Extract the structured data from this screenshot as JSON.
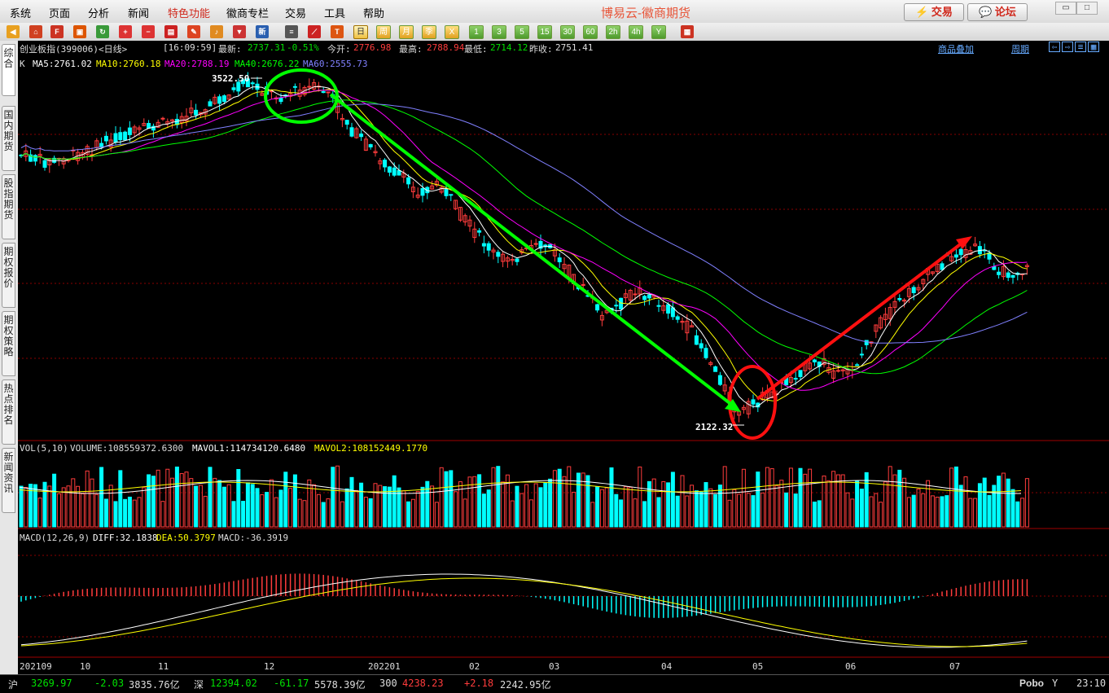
{
  "menu": {
    "items": [
      "系统",
      "页面",
      "分析",
      "新闻",
      "特色功能",
      "徽商专栏",
      "交易",
      "工具",
      "帮助"
    ],
    "title": "博易云-徽商期货",
    "trade_button": "交易",
    "forum_button": "论坛"
  },
  "toolbar": {
    "periods": [
      "日",
      "周",
      "月",
      "季",
      "X",
      "1",
      "3",
      "5",
      "15",
      "30",
      "60",
      "2h",
      "4h",
      "Y"
    ],
    "icons": [
      "back-arrow-icon",
      "home-icon",
      "f10-icon",
      "refresh-icon",
      "zoom-in-icon",
      "zoom-out-icon",
      "window-icon",
      "pen-icon",
      "bell-icon",
      "filter-icon",
      "new-icon",
      "list-icon",
      "chart-line-icon",
      "tick-icon"
    ]
  },
  "sidebar": {
    "tabs": [
      "综合",
      "国内期货",
      "股指期货",
      "期权报价",
      "期权策略",
      "热点排名",
      "新闻资讯"
    ]
  },
  "header": {
    "symbol": "创业板指(399006)<日线>",
    "time": "[16:09:59]",
    "last_label": "最新:",
    "last": "2737.31",
    "change": "-0.51%",
    "open_label": "今开:",
    "open": "2776.98",
    "high_label": "最高:",
    "high": "2788.94",
    "low_label": "最低:",
    "low": "2714.12",
    "prev_label": "昨收:",
    "prev": "2751.41",
    "overlay_link": "商品叠加",
    "period_link": "周期"
  },
  "ma_legend": {
    "prefix": "K",
    "ma5": "MA5:2761.02",
    "ma10": "MA10:2760.18",
    "ma20": "MA20:2788.19",
    "ma40": "MA40:2676.22",
    "ma60": "MA60:2555.73",
    "colors": {
      "ma5": "#ffffff",
      "ma10": "#ffff00",
      "ma20": "#ff00ff",
      "ma40": "#00ff00",
      "ma60": "#8080ff"
    }
  },
  "vol_legend": {
    "name": "VOL(5,10)",
    "volume": "VOLUME:108559372.6300",
    "mavol1": "MAVOL1:114734120.6480",
    "mavol2": "MAVOL2:108152449.1770"
  },
  "macd_legend": {
    "name": "MACD(12,26,9)",
    "diff": "DIFF:32.1838",
    "dea": "DEA:50.3797",
    "macd": "MACD:-36.3919"
  },
  "annotations": {
    "high_label": "3522.50",
    "low_label": "2122.32"
  },
  "x_axis": [
    "202109",
    "10",
    "11",
    "12",
    "202201",
    "02",
    "03",
    "04",
    "05",
    "06",
    "07"
  ],
  "chart_data": {
    "type": "candlestick",
    "symbol": "创业板指(399006)",
    "period": "日线",
    "high_marker": 3522.5,
    "low_marker": 2122.32,
    "last": 2737.31,
    "macd": {
      "diff": 32.1838,
      "dea": 50.3797,
      "macd": -36.3919
    },
    "volume": {
      "volume": 108559372.63,
      "mavol1": 114734120.648,
      "mavol2": 108152449.177
    },
    "trend_arrows": [
      {
        "color": "green",
        "from": "202112",
        "to": "202204"
      },
      {
        "color": "red",
        "from": "202205",
        "to": "202207"
      }
    ],
    "bullish_color": "#ff3c3c",
    "bearish_color": "#00ffff"
  },
  "status": {
    "sh_label": "沪",
    "sh_index": "3269.97",
    "sh_change": "-2.03",
    "sh_amount": "3835.76亿",
    "sz_label": "深",
    "sz_index": "12394.02",
    "sz_change": "-61.17",
    "sz_amount": "5578.39亿",
    "c300_label": "300",
    "c300_index": "4238.23",
    "c300_change": "+2.18",
    "c300_amount": "2242.95亿",
    "brand": "Pobo",
    "clock": "23:10"
  }
}
